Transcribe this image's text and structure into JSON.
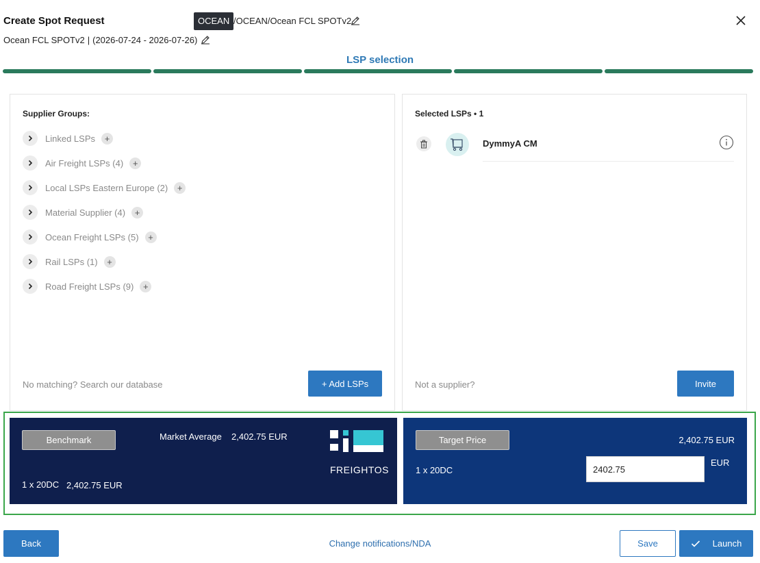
{
  "header": {
    "title": "Create Spot Request",
    "badge": "OCEAN",
    "path": "/OCEAN/Ocean FCL SPOTv2",
    "subtitle_name": "Ocean FCL SPOTv2",
    "subtitle_separator": "|",
    "date_range": "(2026-07-24 - 2026-07-26)",
    "icons": {
      "edit": "pencil-icon",
      "close": "close-icon"
    }
  },
  "stepper": {
    "title": "LSP selection",
    "step_count": 5,
    "completed_steps": 5,
    "color": "#2a7a5c"
  },
  "supplier_groups": {
    "label": "Supplier Groups:",
    "items": [
      {
        "label": "Linked LSPs"
      },
      {
        "label": "Air Freight LSPs (4)"
      },
      {
        "label": "Local LSPs Eastern Europe (2)"
      },
      {
        "label": "Material Supplier (4)"
      },
      {
        "label": "Ocean Freight LSPs (5)"
      },
      {
        "label": "Rail LSPs (1)"
      },
      {
        "label": "Road Freight LSPs (9)"
      }
    ],
    "footer_note": "No matching? Search our database",
    "add_button": "+ Add LSPs"
  },
  "selected_lsps": {
    "label": "Selected LSPs • 1",
    "items": [
      {
        "name": "DymmyA CM"
      }
    ],
    "footer_note": "Not a supplier?",
    "invite_button": "Invite"
  },
  "benchmark": {
    "button": "Benchmark",
    "market_label": "Market Average",
    "market_value": "2,402.75 EUR",
    "container_label": "1 x 20DC",
    "container_value": "2,402.75 EUR",
    "logo_text": "FREIGHTOS",
    "background": "#0f1f4d"
  },
  "target_price": {
    "button": "Target Price",
    "total": "2,402.75 EUR",
    "container_label": "1 x 20DC",
    "input_value": "2402.75",
    "currency": "EUR",
    "background": "#0d367a"
  },
  "footer": {
    "back": "Back",
    "link": "Change notifications/NDA",
    "save": "Save",
    "launch": "Launch"
  }
}
